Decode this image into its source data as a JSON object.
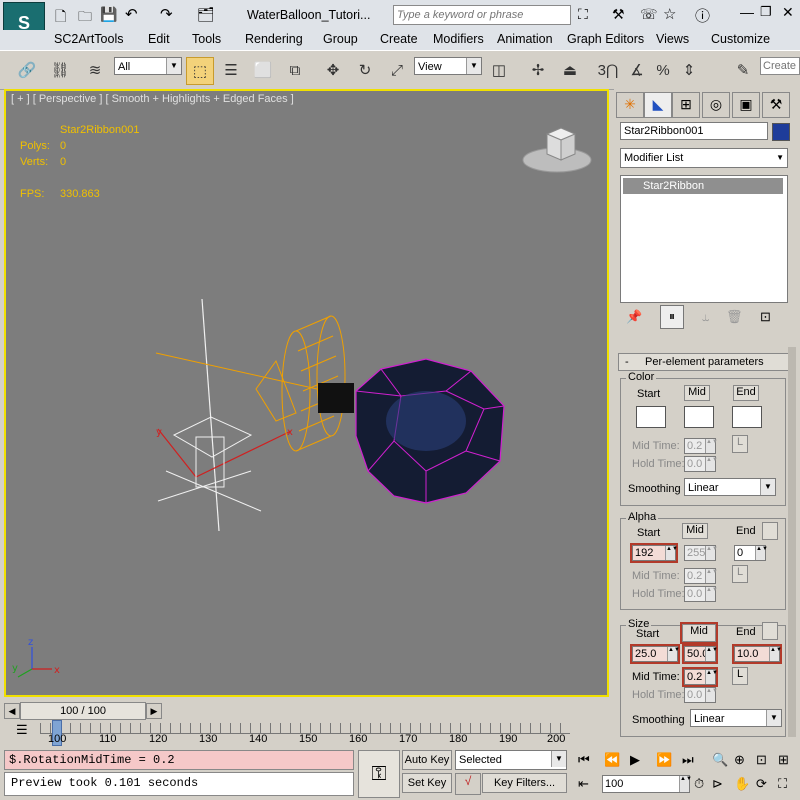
{
  "title_bar": {
    "file_name": "WaterBalloon_Tutori...",
    "search_placeholder": "Type a keyword or phrase"
  },
  "menu": [
    "SC2ArtTools",
    "Edit",
    "Tools",
    "Rendering",
    "Group",
    "Create",
    "Modifiers",
    "Animation",
    "Graph Editors",
    "Views",
    "Customize"
  ],
  "toolbar": {
    "filter_value": "All",
    "coord_value": "View",
    "snap_label": "3",
    "create_sel_placeholder": "Create"
  },
  "viewport": {
    "label": "[ + ] [ Perspective ] [ Smooth + Highlights + Edged Faces ]",
    "object_name": "Star2Ribbon001",
    "polys_label": "Polys:",
    "polys_value": "0",
    "verts_label": "Verts:",
    "verts_value": "0",
    "fps_label": "FPS:",
    "fps_value": "330.863",
    "axis_y": "y",
    "axis_x": "x",
    "gizmo_z": "z",
    "gizmo_x": "x",
    "gizmo_y": "y"
  },
  "command_panel": {
    "object_name": "Star2Ribbon001",
    "object_color": "#1e3c9a",
    "modifier_list_label": "Modifier List",
    "stack_item": "Star2Ribbon",
    "rollout_title": "Per-element parameters",
    "color": {
      "group_label": "Color",
      "start_label": "Start",
      "mid_label": "Mid",
      "end_label": "End",
      "mid_time_label": "Mid Time:",
      "mid_time_value": "0.2",
      "hold_time_label": "Hold Time:",
      "hold_time_value": "0.0",
      "lock_label": "L",
      "smoothing_label": "Smoothing",
      "smoothing_value": "Linear"
    },
    "alpha": {
      "group_label": "Alpha",
      "start_label": "Start",
      "mid_label": "Mid",
      "end_label": "End",
      "start_value": "192",
      "mid_value": "255",
      "end_value": "0",
      "mid_time_label": "Mid Time:",
      "mid_time_value": "0.2",
      "hold_time_label": "Hold Time:",
      "hold_time_value": "0.0",
      "lock_label": "L"
    },
    "size": {
      "group_label": "Size",
      "start_label": "Start",
      "mid_label": "Mid",
      "end_label": "End",
      "start_value": "25.0",
      "mid_value": "50.0",
      "end_value": "10.0",
      "mid_time_label": "Mid Time:",
      "mid_time_value": "0.2",
      "hold_time_label": "Hold Time:",
      "hold_time_value": "0.0",
      "lock_label": "L",
      "smoothing_label": "Smoothing",
      "smoothing_value": "Linear"
    }
  },
  "time_slider": {
    "frame_label": "100 / 100",
    "ticks": [
      "100",
      "110",
      "120",
      "130",
      "140",
      "150",
      "160",
      "170",
      "180",
      "190",
      "200"
    ]
  },
  "status": {
    "maxscript_input": "$.RotationMidTime = 0.2",
    "maxscript_output": "Preview took 0.101 seconds",
    "auto_key_label": "Auto Key",
    "set_key_label": "Set Key",
    "selected_value": "Selected",
    "key_filters_label": "Key Filters...",
    "frame_value": "100"
  }
}
